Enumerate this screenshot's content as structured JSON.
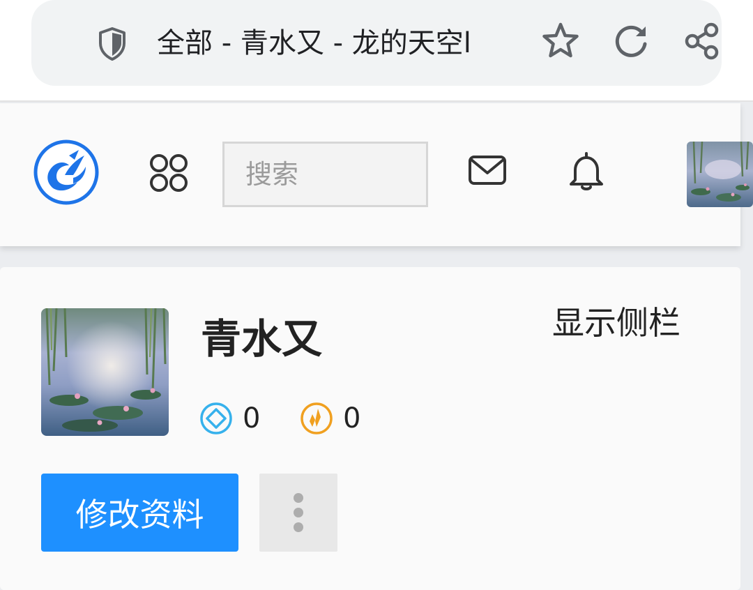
{
  "browser": {
    "tab_title": "全部 - 青水又 - 龙的天空l",
    "icons": [
      "shield-icon",
      "star-icon",
      "reload-icon",
      "share-icon"
    ]
  },
  "header": {
    "logo_icon": "dragon-logo-icon",
    "search_placeholder": "搜索",
    "icons": [
      "apps-icon",
      "mail-icon",
      "bell-icon"
    ],
    "accent_color": "#1e74e8"
  },
  "profile": {
    "username": "青水又",
    "toggle_sidebar_label": "显示侧栏",
    "stats": [
      {
        "icon": "diamond-icon",
        "value": "0",
        "color": "#36b1ec"
      },
      {
        "icon": "points-icon",
        "value": "0",
        "color": "#f0a020"
      }
    ],
    "edit_button_label": "修改资料",
    "primary_color": "#1e90ff"
  }
}
